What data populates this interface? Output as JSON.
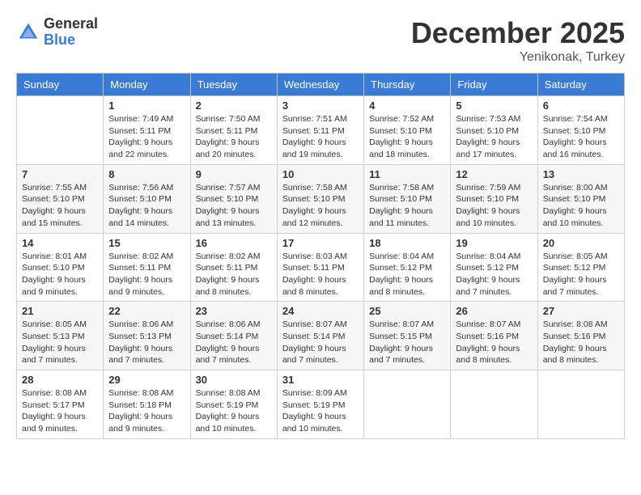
{
  "logo": {
    "general": "General",
    "blue": "Blue"
  },
  "title": "December 2025",
  "location": "Yenikonak, Turkey",
  "days_header": [
    "Sunday",
    "Monday",
    "Tuesday",
    "Wednesday",
    "Thursday",
    "Friday",
    "Saturday"
  ],
  "weeks": [
    [
      {
        "num": "",
        "info": ""
      },
      {
        "num": "1",
        "info": "Sunrise: 7:49 AM\nSunset: 5:11 PM\nDaylight: 9 hours\nand 22 minutes."
      },
      {
        "num": "2",
        "info": "Sunrise: 7:50 AM\nSunset: 5:11 PM\nDaylight: 9 hours\nand 20 minutes."
      },
      {
        "num": "3",
        "info": "Sunrise: 7:51 AM\nSunset: 5:11 PM\nDaylight: 9 hours\nand 19 minutes."
      },
      {
        "num": "4",
        "info": "Sunrise: 7:52 AM\nSunset: 5:10 PM\nDaylight: 9 hours\nand 18 minutes."
      },
      {
        "num": "5",
        "info": "Sunrise: 7:53 AM\nSunset: 5:10 PM\nDaylight: 9 hours\nand 17 minutes."
      },
      {
        "num": "6",
        "info": "Sunrise: 7:54 AM\nSunset: 5:10 PM\nDaylight: 9 hours\nand 16 minutes."
      }
    ],
    [
      {
        "num": "7",
        "info": "Sunrise: 7:55 AM\nSunset: 5:10 PM\nDaylight: 9 hours\nand 15 minutes."
      },
      {
        "num": "8",
        "info": "Sunrise: 7:56 AM\nSunset: 5:10 PM\nDaylight: 9 hours\nand 14 minutes."
      },
      {
        "num": "9",
        "info": "Sunrise: 7:57 AM\nSunset: 5:10 PM\nDaylight: 9 hours\nand 13 minutes."
      },
      {
        "num": "10",
        "info": "Sunrise: 7:58 AM\nSunset: 5:10 PM\nDaylight: 9 hours\nand 12 minutes."
      },
      {
        "num": "11",
        "info": "Sunrise: 7:58 AM\nSunset: 5:10 PM\nDaylight: 9 hours\nand 11 minutes."
      },
      {
        "num": "12",
        "info": "Sunrise: 7:59 AM\nSunset: 5:10 PM\nDaylight: 9 hours\nand 10 minutes."
      },
      {
        "num": "13",
        "info": "Sunrise: 8:00 AM\nSunset: 5:10 PM\nDaylight: 9 hours\nand 10 minutes."
      }
    ],
    [
      {
        "num": "14",
        "info": "Sunrise: 8:01 AM\nSunset: 5:10 PM\nDaylight: 9 hours\nand 9 minutes."
      },
      {
        "num": "15",
        "info": "Sunrise: 8:02 AM\nSunset: 5:11 PM\nDaylight: 9 hours\nand 9 minutes."
      },
      {
        "num": "16",
        "info": "Sunrise: 8:02 AM\nSunset: 5:11 PM\nDaylight: 9 hours\nand 8 minutes."
      },
      {
        "num": "17",
        "info": "Sunrise: 8:03 AM\nSunset: 5:11 PM\nDaylight: 9 hours\nand 8 minutes."
      },
      {
        "num": "18",
        "info": "Sunrise: 8:04 AM\nSunset: 5:12 PM\nDaylight: 9 hours\nand 8 minutes."
      },
      {
        "num": "19",
        "info": "Sunrise: 8:04 AM\nSunset: 5:12 PM\nDaylight: 9 hours\nand 7 minutes."
      },
      {
        "num": "20",
        "info": "Sunrise: 8:05 AM\nSunset: 5:12 PM\nDaylight: 9 hours\nand 7 minutes."
      }
    ],
    [
      {
        "num": "21",
        "info": "Sunrise: 8:05 AM\nSunset: 5:13 PM\nDaylight: 9 hours\nand 7 minutes."
      },
      {
        "num": "22",
        "info": "Sunrise: 8:06 AM\nSunset: 5:13 PM\nDaylight: 9 hours\nand 7 minutes."
      },
      {
        "num": "23",
        "info": "Sunrise: 8:06 AM\nSunset: 5:14 PM\nDaylight: 9 hours\nand 7 minutes."
      },
      {
        "num": "24",
        "info": "Sunrise: 8:07 AM\nSunset: 5:14 PM\nDaylight: 9 hours\nand 7 minutes."
      },
      {
        "num": "25",
        "info": "Sunrise: 8:07 AM\nSunset: 5:15 PM\nDaylight: 9 hours\nand 7 minutes."
      },
      {
        "num": "26",
        "info": "Sunrise: 8:07 AM\nSunset: 5:16 PM\nDaylight: 9 hours\nand 8 minutes."
      },
      {
        "num": "27",
        "info": "Sunrise: 8:08 AM\nSunset: 5:16 PM\nDaylight: 9 hours\nand 8 minutes."
      }
    ],
    [
      {
        "num": "28",
        "info": "Sunrise: 8:08 AM\nSunset: 5:17 PM\nDaylight: 9 hours\nand 9 minutes."
      },
      {
        "num": "29",
        "info": "Sunrise: 8:08 AM\nSunset: 5:18 PM\nDaylight: 9 hours\nand 9 minutes."
      },
      {
        "num": "30",
        "info": "Sunrise: 8:08 AM\nSunset: 5:19 PM\nDaylight: 9 hours\nand 10 minutes."
      },
      {
        "num": "31",
        "info": "Sunrise: 8:09 AM\nSunset: 5:19 PM\nDaylight: 9 hours\nand 10 minutes."
      },
      {
        "num": "",
        "info": ""
      },
      {
        "num": "",
        "info": ""
      },
      {
        "num": "",
        "info": ""
      }
    ]
  ]
}
